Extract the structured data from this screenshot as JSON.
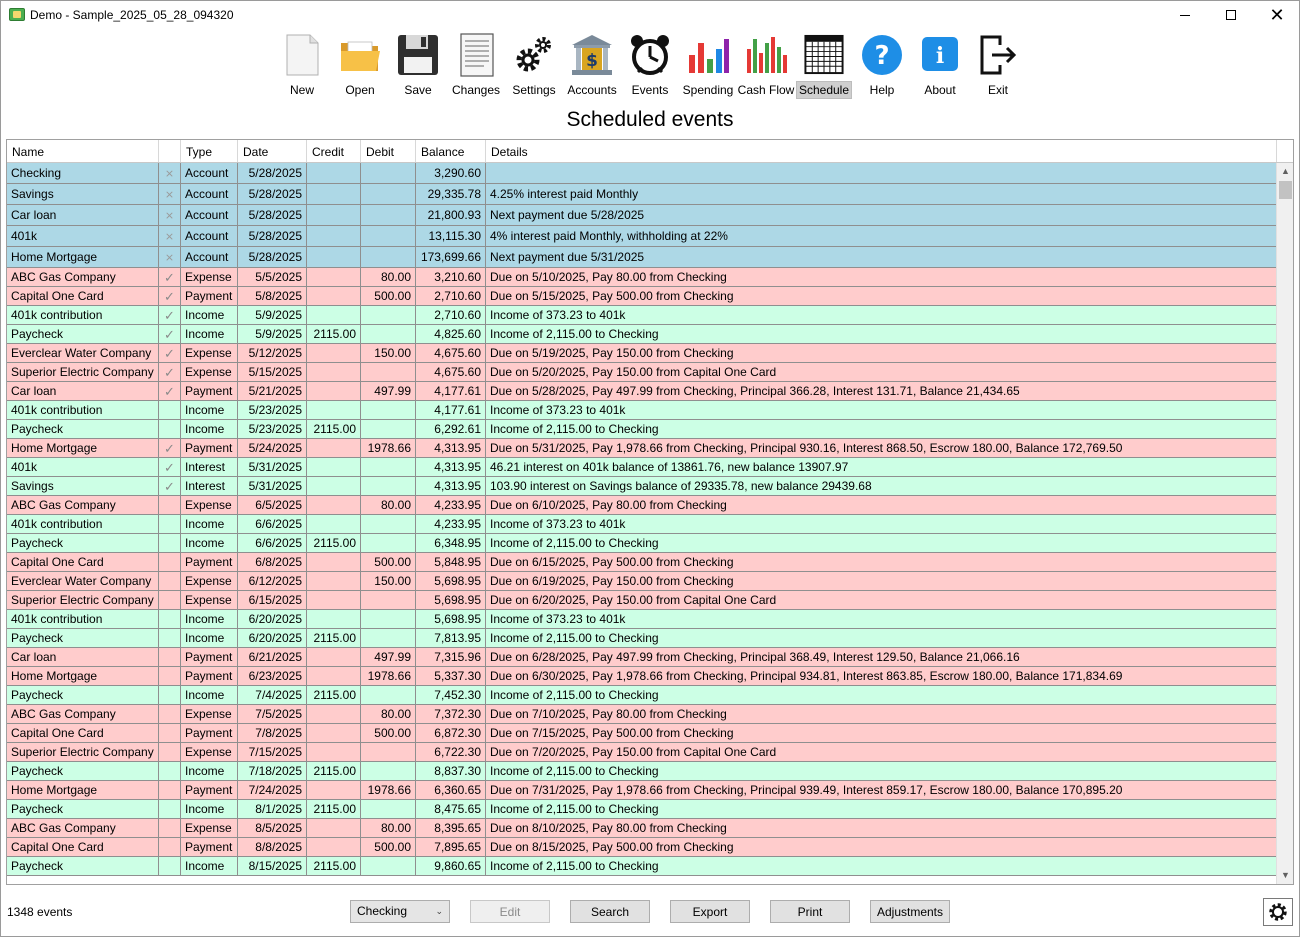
{
  "window": {
    "title": "Demo - Sample_2025_05_28_094320"
  },
  "toolbar": {
    "buttons": [
      {
        "label": "New",
        "icon": "new-document-icon"
      },
      {
        "label": "Open",
        "icon": "open-folder-icon"
      },
      {
        "label": "Save",
        "icon": "floppy-disk-icon"
      },
      {
        "label": "Changes",
        "icon": "changes-document-icon"
      },
      {
        "label": "Settings",
        "icon": "gears-icon"
      },
      {
        "label": "Accounts",
        "icon": "bank-icon"
      },
      {
        "label": "Events",
        "icon": "alarm-clock-icon"
      },
      {
        "label": "Spending",
        "icon": "bar-chart-icon"
      },
      {
        "label": "Cash Flow",
        "icon": "cash-flow-chart-icon"
      },
      {
        "label": "Schedule",
        "icon": "schedule-grid-icon"
      },
      {
        "label": "Help",
        "icon": "help-icon"
      },
      {
        "label": "About",
        "icon": "info-icon"
      },
      {
        "label": "Exit",
        "icon": "exit-icon"
      }
    ],
    "active": "Schedule"
  },
  "view_title": "Scheduled events",
  "columns": [
    "Name",
    "",
    "Type",
    "Date",
    "Credit",
    "Debit",
    "Balance",
    "Details"
  ],
  "rows": [
    {
      "name": "Checking",
      "mark": "x",
      "type": "Account",
      "date": "5/28/2025",
      "credit": "",
      "debit": "",
      "balance": "3,290.60",
      "details": "",
      "kind": "acct"
    },
    {
      "name": "Savings",
      "mark": "x",
      "type": "Account",
      "date": "5/28/2025",
      "credit": "",
      "debit": "",
      "balance": "29,335.78",
      "details": "4.25% interest paid Monthly",
      "kind": "acct"
    },
    {
      "name": "Car loan",
      "mark": "x",
      "type": "Account",
      "date": "5/28/2025",
      "credit": "",
      "debit": "",
      "balance": "21,800.93",
      "details": "Next payment due 5/28/2025",
      "kind": "acct"
    },
    {
      "name": "401k",
      "mark": "x",
      "type": "Account",
      "date": "5/28/2025",
      "credit": "",
      "debit": "",
      "balance": "13,115.30",
      "details": "4% interest paid Monthly, withholding at 22%",
      "kind": "acct"
    },
    {
      "name": "Home Mortgage",
      "mark": "x",
      "type": "Account",
      "date": "5/28/2025",
      "credit": "",
      "debit": "",
      "balance": "173,699.66",
      "details": "Next payment due 5/31/2025",
      "kind": "acct"
    },
    {
      "name": "ABC Gas Company",
      "mark": "check",
      "type": "Expense",
      "date": "5/5/2025",
      "credit": "",
      "debit": "80.00",
      "balance": "3,210.60",
      "details": "Due on 5/10/2025, Pay 80.00 from Checking",
      "kind": "expense"
    },
    {
      "name": "Capital One Card",
      "mark": "check",
      "type": "Payment",
      "date": "5/8/2025",
      "credit": "",
      "debit": "500.00",
      "balance": "2,710.60",
      "details": "Due on 5/15/2025, Pay 500.00 from Checking",
      "kind": "expense"
    },
    {
      "name": "401k contribution",
      "mark": "check",
      "type": "Income",
      "date": "5/9/2025",
      "credit": "",
      "debit": "",
      "balance": "2,710.60",
      "details": "Income of 373.23 to 401k",
      "kind": "income"
    },
    {
      "name": "Paycheck",
      "mark": "check",
      "type": "Income",
      "date": "5/9/2025",
      "credit": "2115.00",
      "debit": "",
      "balance": "4,825.60",
      "details": "Income of 2,115.00 to Checking",
      "kind": "income"
    },
    {
      "name": "Everclear Water Company",
      "mark": "check",
      "type": "Expense",
      "date": "5/12/2025",
      "credit": "",
      "debit": "150.00",
      "balance": "4,675.60",
      "details": "Due on 5/19/2025, Pay 150.00 from Checking",
      "kind": "expense"
    },
    {
      "name": "Superior Electric Company",
      "mark": "check",
      "type": "Expense",
      "date": "5/15/2025",
      "credit": "",
      "debit": "",
      "balance": "4,675.60",
      "details": "Due on 5/20/2025, Pay 150.00 from Capital One Card",
      "kind": "expense"
    },
    {
      "name": "Car loan",
      "mark": "check",
      "type": "Payment",
      "date": "5/21/2025",
      "credit": "",
      "debit": "497.99",
      "balance": "4,177.61",
      "details": "Due on 5/28/2025, Pay 497.99 from Checking, Principal 366.28, Interest 131.71, Balance 21,434.65",
      "kind": "expense"
    },
    {
      "name": "401k contribution",
      "mark": "",
      "type": "Income",
      "date": "5/23/2025",
      "credit": "",
      "debit": "",
      "balance": "4,177.61",
      "details": "Income of 373.23 to 401k",
      "kind": "income"
    },
    {
      "name": "Paycheck",
      "mark": "",
      "type": "Income",
      "date": "5/23/2025",
      "credit": "2115.00",
      "debit": "",
      "balance": "6,292.61",
      "details": "Income of 2,115.00 to Checking",
      "kind": "income"
    },
    {
      "name": "Home Mortgage",
      "mark": "check",
      "type": "Payment",
      "date": "5/24/2025",
      "credit": "",
      "debit": "1978.66",
      "balance": "4,313.95",
      "details": "Due on 5/31/2025, Pay 1,978.66 from Checking, Principal 930.16, Interest 868.50, Escrow 180.00, Balance 172,769.50",
      "kind": "expense"
    },
    {
      "name": "401k",
      "mark": "check",
      "type": "Interest",
      "date": "5/31/2025",
      "credit": "",
      "debit": "",
      "balance": "4,313.95",
      "details": "46.21 interest on 401k balance of 13861.76, new balance 13907.97",
      "kind": "income"
    },
    {
      "name": "Savings",
      "mark": "check",
      "type": "Interest",
      "date": "5/31/2025",
      "credit": "",
      "debit": "",
      "balance": "4,313.95",
      "details": "103.90 interest on Savings balance of 29335.78, new balance 29439.68",
      "kind": "income"
    },
    {
      "name": "ABC Gas Company",
      "mark": "",
      "type": "Expense",
      "date": "6/5/2025",
      "credit": "",
      "debit": "80.00",
      "balance": "4,233.95",
      "details": "Due on 6/10/2025, Pay 80.00 from Checking",
      "kind": "expense"
    },
    {
      "name": "401k contribution",
      "mark": "",
      "type": "Income",
      "date": "6/6/2025",
      "credit": "",
      "debit": "",
      "balance": "4,233.95",
      "details": "Income of 373.23 to 401k",
      "kind": "income"
    },
    {
      "name": "Paycheck",
      "mark": "",
      "type": "Income",
      "date": "6/6/2025",
      "credit": "2115.00",
      "debit": "",
      "balance": "6,348.95",
      "details": "Income of 2,115.00 to Checking",
      "kind": "income"
    },
    {
      "name": "Capital One Card",
      "mark": "",
      "type": "Payment",
      "date": "6/8/2025",
      "credit": "",
      "debit": "500.00",
      "balance": "5,848.95",
      "details": "Due on 6/15/2025, Pay 500.00 from Checking",
      "kind": "expense"
    },
    {
      "name": "Everclear Water Company",
      "mark": "",
      "type": "Expense",
      "date": "6/12/2025",
      "credit": "",
      "debit": "150.00",
      "balance": "5,698.95",
      "details": "Due on 6/19/2025, Pay 150.00 from Checking",
      "kind": "expense"
    },
    {
      "name": "Superior Electric Company",
      "mark": "",
      "type": "Expense",
      "date": "6/15/2025",
      "credit": "",
      "debit": "",
      "balance": "5,698.95",
      "details": "Due on 6/20/2025, Pay 150.00 from Capital One Card",
      "kind": "expense"
    },
    {
      "name": "401k contribution",
      "mark": "",
      "type": "Income",
      "date": "6/20/2025",
      "credit": "",
      "debit": "",
      "balance": "5,698.95",
      "details": "Income of 373.23 to 401k",
      "kind": "income"
    },
    {
      "name": "Paycheck",
      "mark": "",
      "type": "Income",
      "date": "6/20/2025",
      "credit": "2115.00",
      "debit": "",
      "balance": "7,813.95",
      "details": "Income of 2,115.00 to Checking",
      "kind": "income"
    },
    {
      "name": "Car loan",
      "mark": "",
      "type": "Payment",
      "date": "6/21/2025",
      "credit": "",
      "debit": "497.99",
      "balance": "7,315.96",
      "details": "Due on 6/28/2025, Pay 497.99 from Checking, Principal 368.49, Interest 129.50, Balance 21,066.16",
      "kind": "expense"
    },
    {
      "name": "Home Mortgage",
      "mark": "",
      "type": "Payment",
      "date": "6/23/2025",
      "credit": "",
      "debit": "1978.66",
      "balance": "5,337.30",
      "details": "Due on 6/30/2025, Pay 1,978.66 from Checking, Principal 934.81, Interest 863.85, Escrow 180.00, Balance 171,834.69",
      "kind": "expense"
    },
    {
      "name": "Paycheck",
      "mark": "",
      "type": "Income",
      "date": "7/4/2025",
      "credit": "2115.00",
      "debit": "",
      "balance": "7,452.30",
      "details": "Income of 2,115.00 to Checking",
      "kind": "income"
    },
    {
      "name": "ABC Gas Company",
      "mark": "",
      "type": "Expense",
      "date": "7/5/2025",
      "credit": "",
      "debit": "80.00",
      "balance": "7,372.30",
      "details": "Due on 7/10/2025, Pay 80.00 from Checking",
      "kind": "expense"
    },
    {
      "name": "Capital One Card",
      "mark": "",
      "type": "Payment",
      "date": "7/8/2025",
      "credit": "",
      "debit": "500.00",
      "balance": "6,872.30",
      "details": "Due on 7/15/2025, Pay 500.00 from Checking",
      "kind": "expense"
    },
    {
      "name": "Superior Electric Company",
      "mark": "",
      "type": "Expense",
      "date": "7/15/2025",
      "credit": "",
      "debit": "",
      "balance": "6,722.30",
      "details": "Due on 7/20/2025, Pay 150.00 from Capital One Card",
      "kind": "expense"
    },
    {
      "name": "Paycheck",
      "mark": "",
      "type": "Income",
      "date": "7/18/2025",
      "credit": "2115.00",
      "debit": "",
      "balance": "8,837.30",
      "details": "Income of 2,115.00 to Checking",
      "kind": "income"
    },
    {
      "name": "Home Mortgage",
      "mark": "",
      "type": "Payment",
      "date": "7/24/2025",
      "credit": "",
      "debit": "1978.66",
      "balance": "6,360.65",
      "details": "Due on 7/31/2025, Pay 1,978.66 from Checking, Principal 939.49, Interest 859.17, Escrow 180.00, Balance 170,895.20",
      "kind": "expense"
    },
    {
      "name": "Paycheck",
      "mark": "",
      "type": "Income",
      "date": "8/1/2025",
      "credit": "2115.00",
      "debit": "",
      "balance": "8,475.65",
      "details": "Income of 2,115.00 to Checking",
      "kind": "income"
    },
    {
      "name": "ABC Gas Company",
      "mark": "",
      "type": "Expense",
      "date": "8/5/2025",
      "credit": "",
      "debit": "80.00",
      "balance": "8,395.65",
      "details": "Due on 8/10/2025, Pay 80.00 from Checking",
      "kind": "expense"
    },
    {
      "name": "Capital One Card",
      "mark": "",
      "type": "Payment",
      "date": "8/8/2025",
      "credit": "",
      "debit": "500.00",
      "balance": "7,895.65",
      "details": "Due on 8/15/2025, Pay 500.00 from Checking",
      "kind": "expense"
    },
    {
      "name": "Paycheck",
      "mark": "",
      "type": "Income",
      "date": "8/15/2025",
      "credit": "2115.00",
      "debit": "",
      "balance": "9,860.65",
      "details": "Income of 2,115.00 to Checking",
      "kind": "income"
    }
  ],
  "footer": {
    "status": "1348 events",
    "account_select": "Checking",
    "buttons": [
      "Edit",
      "Search",
      "Export",
      "Print",
      "Adjustments"
    ],
    "settings_icon": "gear-icon"
  },
  "colors": {
    "account": "#add8e6",
    "expense": "#ffcccc",
    "income": "#ccffe5"
  }
}
